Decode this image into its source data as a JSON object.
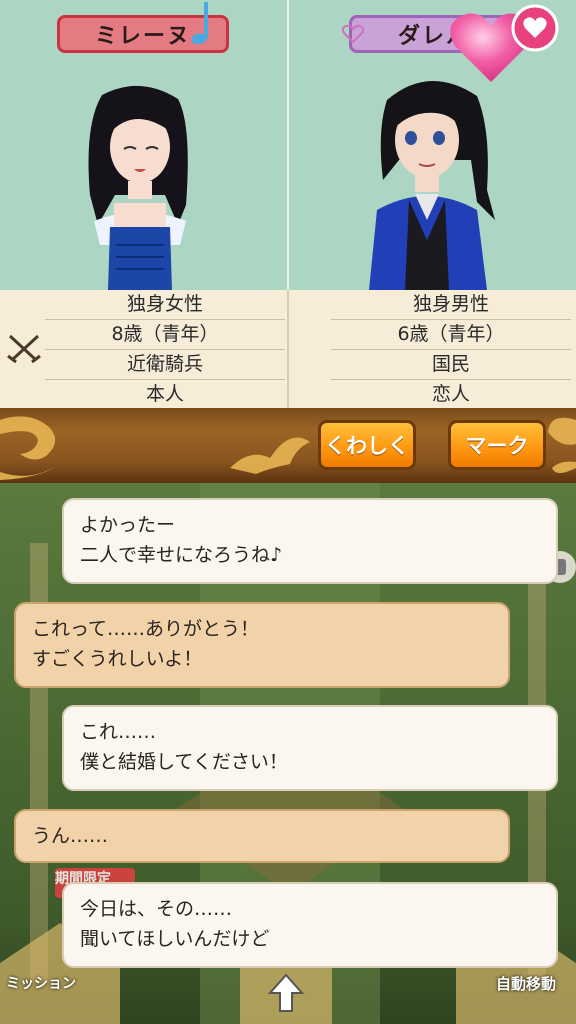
{
  "left_character": {
    "name": "ミレーヌ",
    "info": [
      "独身女性",
      "8歳（青年）",
      "近衛騎兵",
      "本人"
    ]
  },
  "right_character": {
    "name": "ダレル",
    "info": [
      "独身男性",
      "6歳（青年）",
      "国民",
      "恋人"
    ]
  },
  "buttons": {
    "details": "くわしく",
    "mark": "マーク"
  },
  "messages": [
    {
      "speaker": "right",
      "style": "white",
      "lines": [
        "よかったー",
        "二人で幸せになろうね♪"
      ]
    },
    {
      "speaker": "left",
      "style": "tan",
      "lines": [
        "これって……ありがとう！",
        "すごくうれしいよ！"
      ]
    },
    {
      "speaker": "right",
      "style": "white",
      "lines": [
        "これ……",
        "僕と結婚してください！"
      ]
    },
    {
      "speaker": "left",
      "style": "tan",
      "lines": [
        "うん……"
      ]
    },
    {
      "speaker": "right",
      "style": "white",
      "lines": [
        "今日は、その……",
        "聞いてほしいんだけど"
      ]
    }
  ],
  "hud": {
    "mission": "ミッション",
    "auto_move": "自動移動",
    "badge": "期間限定"
  },
  "colors": {
    "panel_bg": "#acd6c3",
    "button_orange": "#ff9a12",
    "female_plate": "#e57b82",
    "male_plate": "#c9a2d8"
  }
}
